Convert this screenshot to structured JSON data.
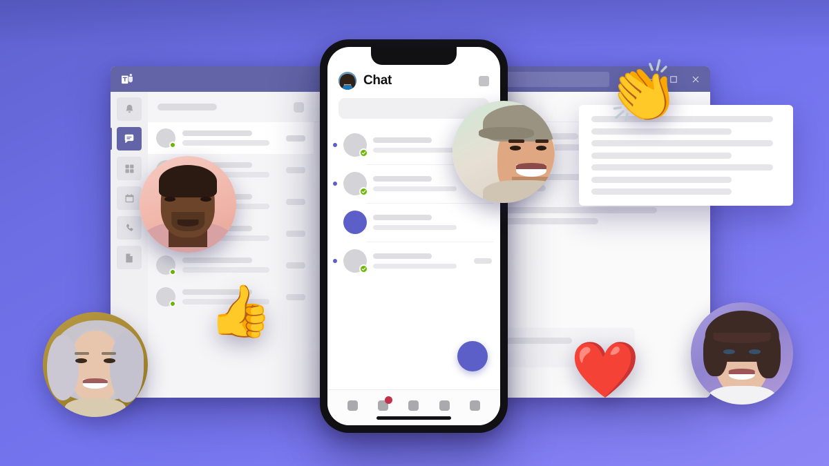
{
  "background": {
    "color_start": "#5f62cf",
    "color_end": "#8d86f5"
  },
  "desktop_window": {
    "app_name": "Microsoft Teams",
    "titlebar": {
      "logo_icon": "microsoft-teams-logo-icon",
      "back_icon": "chevron-left-icon",
      "forward_icon": "chevron-right-icon",
      "search_placeholder": "",
      "more_icon": "ellipsis-icon",
      "minimize_icon": "minimize-icon",
      "maximize_icon": "maximize-icon",
      "close_icon": "close-icon",
      "accent_color": "#6264a7"
    },
    "rail": {
      "items": [
        {
          "name": "activity",
          "icon": "bell-icon",
          "active": false
        },
        {
          "name": "chat",
          "icon": "chat-icon",
          "active": true
        },
        {
          "name": "teams",
          "icon": "teams-icon",
          "active": false
        },
        {
          "name": "calendar",
          "icon": "calendar-icon",
          "active": false
        },
        {
          "name": "calls",
          "icon": "phone-icon",
          "active": false
        },
        {
          "name": "files",
          "icon": "file-icon",
          "active": false
        }
      ]
    },
    "chat_list": {
      "header_title_placeholder": "",
      "header_action_icon": "compose-icon",
      "rows": [
        {
          "selected": true,
          "presence": "available",
          "has_timestamp": true
        },
        {
          "selected": false,
          "presence": "available",
          "has_timestamp": true
        },
        {
          "selected": false,
          "presence": "available",
          "has_timestamp": true
        },
        {
          "selected": false,
          "presence": "available",
          "has_timestamp": true
        },
        {
          "selected": false,
          "presence": "available",
          "has_timestamp": true
        },
        {
          "selected": false,
          "presence": "available",
          "has_timestamp": true
        }
      ]
    },
    "conversation": {
      "header_title_placeholder": "",
      "messages": [
        {
          "unread": true,
          "presence": "available",
          "line_widths": [
            "64%",
            "92%",
            "44%"
          ]
        },
        {
          "unread": false,
          "presence": "available",
          "line_widths": [
            "78%",
            "54%"
          ]
        },
        {
          "unread": false,
          "presence": "available",
          "line_widths": [
            "88%",
            "70%",
            "38%"
          ]
        }
      ],
      "compose_card_lines": [
        "82%",
        "50%"
      ]
    }
  },
  "float_card": {
    "name": "floating-content-card",
    "lines": [
      "96%",
      "74%",
      "96%",
      "74%",
      "96%",
      "74%",
      "74%"
    ]
  },
  "phone": {
    "status_notch": "notch",
    "header": {
      "avatar_icon": "profile-avatar",
      "title": "Chat",
      "action_icon": "compose-icon"
    },
    "search_placeholder": "",
    "rows": [
      {
        "unread": true,
        "avatar": "gray",
        "presence": "available",
        "has_timestamp": false
      },
      {
        "unread": true,
        "avatar": "gray",
        "presence": "available",
        "has_timestamp": false
      },
      {
        "unread": false,
        "avatar": "purple",
        "presence": "none",
        "has_timestamp": false
      },
      {
        "unread": true,
        "avatar": "gray",
        "presence": "available",
        "has_timestamp": true
      }
    ],
    "fab_icon": "new-chat-fab",
    "tabs": [
      {
        "name": "activity",
        "badge": null
      },
      {
        "name": "chat",
        "badge": "unread"
      },
      {
        "name": "teams",
        "badge": null
      },
      {
        "name": "calendar",
        "badge": null
      },
      {
        "name": "more",
        "badge": null
      }
    ],
    "home_indicator": true
  },
  "people": [
    {
      "id": "man-pink",
      "label": "smiling-man-pink-background",
      "bg": "#f0b8ae"
    },
    {
      "id": "man-green",
      "label": "smiling-man-with-cap",
      "bg": "#c7e3cf"
    },
    {
      "id": "woman-gold",
      "label": "smiling-older-woman",
      "bg": "#a98b33"
    },
    {
      "id": "woman-purple",
      "label": "smiling-woman-short-hair",
      "bg": "#9b8ed6"
    }
  ],
  "emoji": [
    {
      "id": "clap",
      "glyph": "👏",
      "label": "clapping-hands-emoji"
    },
    {
      "id": "thumbs",
      "glyph": "👍",
      "label": "thumbs-up-emoji"
    },
    {
      "id": "heart",
      "glyph": "❤️",
      "label": "red-heart-emoji"
    }
  ]
}
